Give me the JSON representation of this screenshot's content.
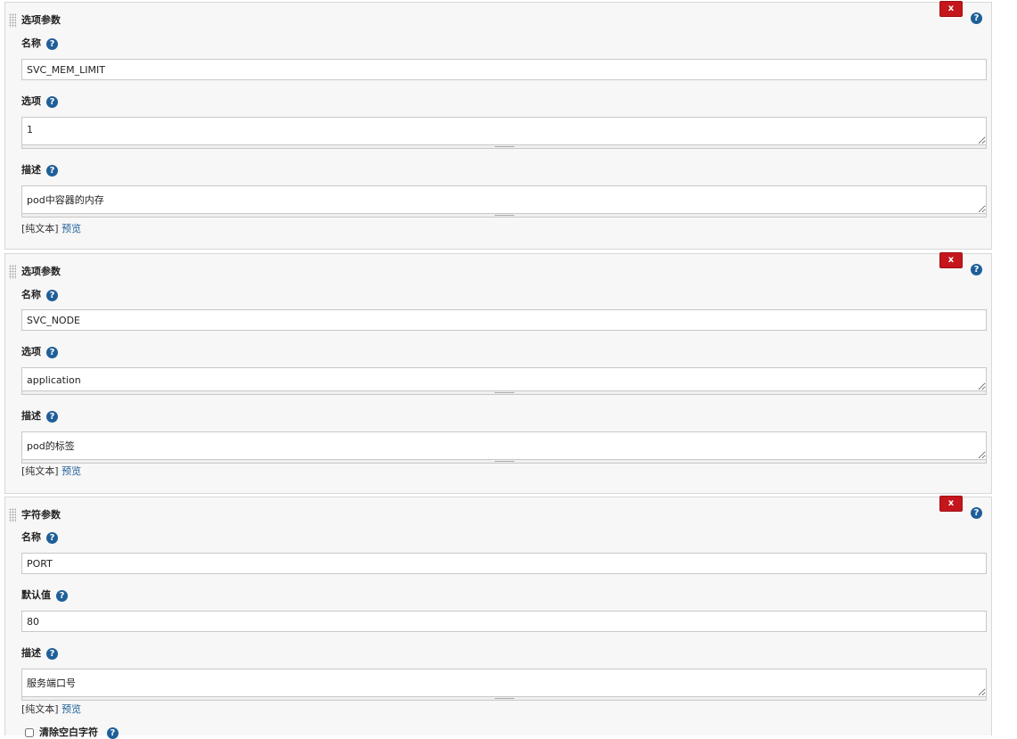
{
  "panels": [
    {
      "title": "选项参数",
      "close_label": "x",
      "fields": {
        "name_label": "名称",
        "name_value": "SVC_MEM_LIMIT",
        "choices_label": "选项",
        "choices_value": "1",
        "desc_label": "描述",
        "desc_value": "pod中容器的内存"
      },
      "format_label": "[纯文本]",
      "preview_label": "预览"
    },
    {
      "title": "选项参数",
      "close_label": "x",
      "fields": {
        "name_label": "名称",
        "name_value": "SVC_NODE",
        "choices_label": "选项",
        "choices_value": "application",
        "desc_label": "描述",
        "desc_value": "pod的标签"
      },
      "format_label": "[纯文本]",
      "preview_label": "预览"
    },
    {
      "title": "字符参数",
      "close_label": "x",
      "fields": {
        "name_label": "名称",
        "name_value": "PORT",
        "default_label": "默认值",
        "default_value": "80",
        "desc_label": "描述",
        "desc_value": "服务端口号"
      },
      "format_label": "[纯文本]",
      "preview_label": "预览",
      "trim_label": "清除空白字符"
    }
  ],
  "help_icon_glyph": "?",
  "colors": {
    "close": "#c4161c",
    "help": "#1f5f99",
    "link": "#1f5f99"
  }
}
